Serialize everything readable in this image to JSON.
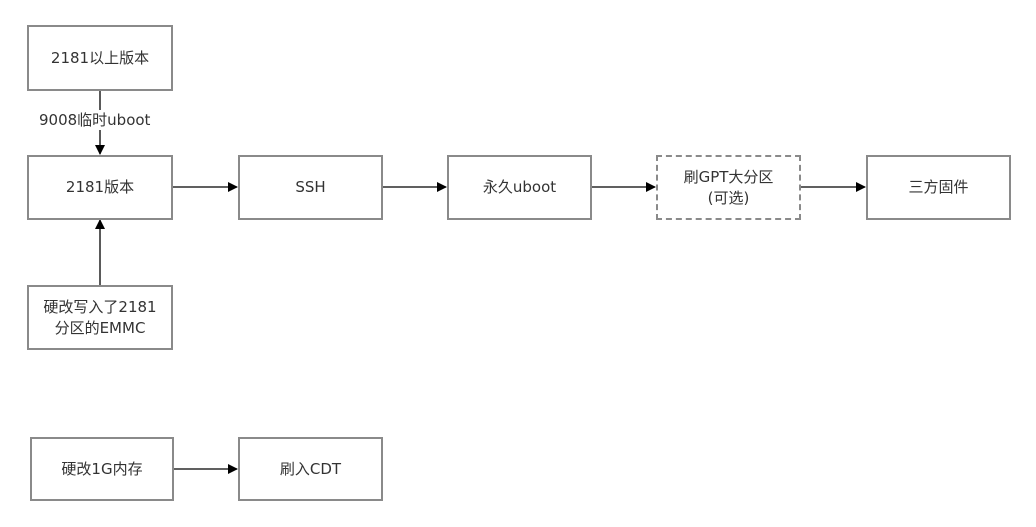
{
  "nodes": {
    "above_2181": "2181以上版本",
    "v2181": "2181版本",
    "ssh": "SSH",
    "perm_uboot": "永久uboot",
    "gpt_line1": "刷GPT大分区",
    "gpt_line2": "(可选)",
    "third_party": "三方固件",
    "emmc_line1": "硬改写入了2181",
    "emmc_line2": "分区的EMMC",
    "hw_1g": "硬改1G内存",
    "flash_cdt": "刷入CDT"
  },
  "edges": {
    "temp_uboot_label": "9008临时uboot"
  }
}
